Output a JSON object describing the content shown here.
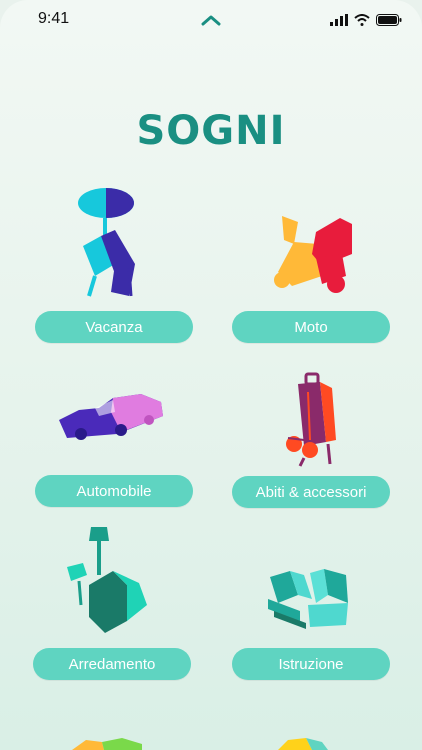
{
  "status_bar": {
    "time": "9:41",
    "icons": [
      "chevron-up-icon",
      "cellular-signal-icon",
      "wifi-icon",
      "battery-icon"
    ]
  },
  "page": {
    "title": "SOGNI"
  },
  "categories": [
    {
      "label": "Vacanza",
      "icon": "beach-umbrella-chair-icon"
    },
    {
      "label": "Moto",
      "icon": "scooter-icon"
    },
    {
      "label": "Automobile",
      "icon": "car-icon"
    },
    {
      "label": "Abiti & accessori",
      "icon": "suitcase-sunglasses-icon"
    },
    {
      "label": "Arredamento",
      "icon": "lamp-furniture-icon"
    },
    {
      "label": "Istruzione",
      "icon": "books-icon"
    }
  ],
  "colors": {
    "accent": "#1a8f82",
    "button": "#5fd4c1",
    "button_text": "#ffffff"
  }
}
